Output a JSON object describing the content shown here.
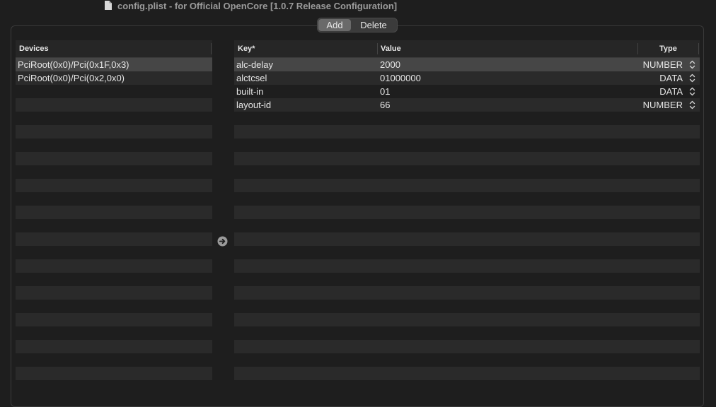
{
  "window": {
    "title": "config.plist - for Official OpenCore [1.0.7 Release Configuration]"
  },
  "segmented": {
    "add_label": "Add",
    "delete_label": "Delete"
  },
  "devices_table": {
    "header": "Devices",
    "rows": [
      "PciRoot(0x0)/Pci(0x1F,0x3)",
      "PciRoot(0x0)/Pci(0x2,0x0)"
    ],
    "selected_index": 0
  },
  "properties_table": {
    "headers": {
      "key": "Key*",
      "value": "Value",
      "type": "Type"
    },
    "rows": [
      {
        "key": "alc-delay",
        "value": "2000",
        "type": "NUMBER"
      },
      {
        "key": "alctcsel",
        "value": "01000000",
        "type": "DATA"
      },
      {
        "key": "built-in",
        "value": "01",
        "type": "DATA"
      },
      {
        "key": "layout-id",
        "value": "66",
        "type": "NUMBER"
      }
    ],
    "selected_index": 0
  },
  "icons": {
    "document": "document-icon",
    "arrow": "arrow-right-circle-icon",
    "stepper": "up-down-chevron-icon"
  },
  "colors": {
    "background": "#1e1e1e",
    "row_alt": "#2a2a2a",
    "row_selected": "#464646",
    "title_text": "#9b9b9b"
  }
}
